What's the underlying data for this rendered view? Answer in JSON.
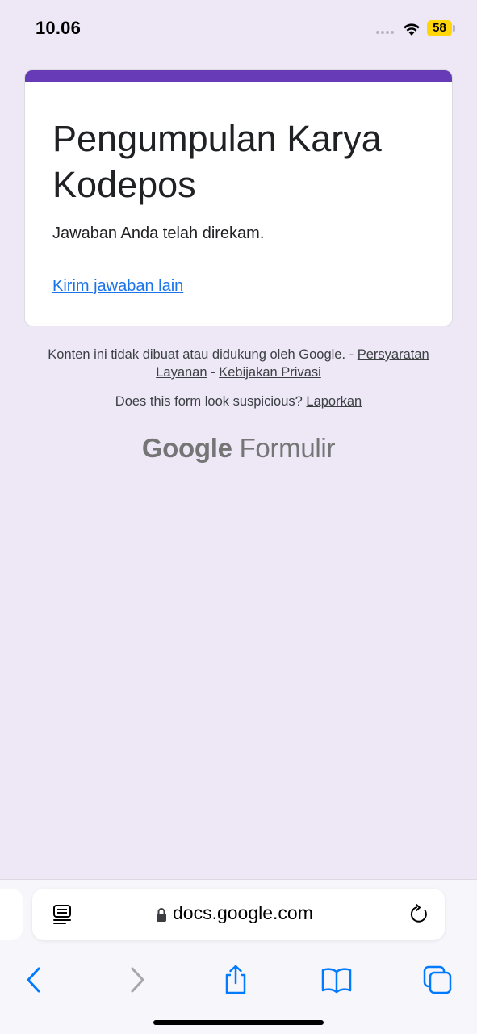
{
  "status_bar": {
    "time": "10.06",
    "battery": "58"
  },
  "form": {
    "title": "Pengumpulan Karya Kodepos",
    "confirmation": "Jawaban Anda telah direkam.",
    "submit_another_link": "Kirim jawaban lain",
    "accent_color": "#673ab7"
  },
  "footer": {
    "disclaimer": "Konten ini tidak dibuat atau didukung oleh Google. -",
    "terms_link": "Persyaratan Layanan",
    "separator": "-",
    "privacy_link": "Kebijakan Privasi",
    "report_question": "Does this form look suspicious?",
    "report_link": "Laporkan",
    "logo_google": "Google",
    "logo_product": "Formulir"
  },
  "browser": {
    "url": "docs.google.com",
    "icons": [
      "reader-icon",
      "lock-icon",
      "reload-icon",
      "back-icon",
      "forward-icon",
      "share-icon",
      "bookmarks-icon",
      "tabs-icon"
    ],
    "tint_color": "#007aff"
  }
}
